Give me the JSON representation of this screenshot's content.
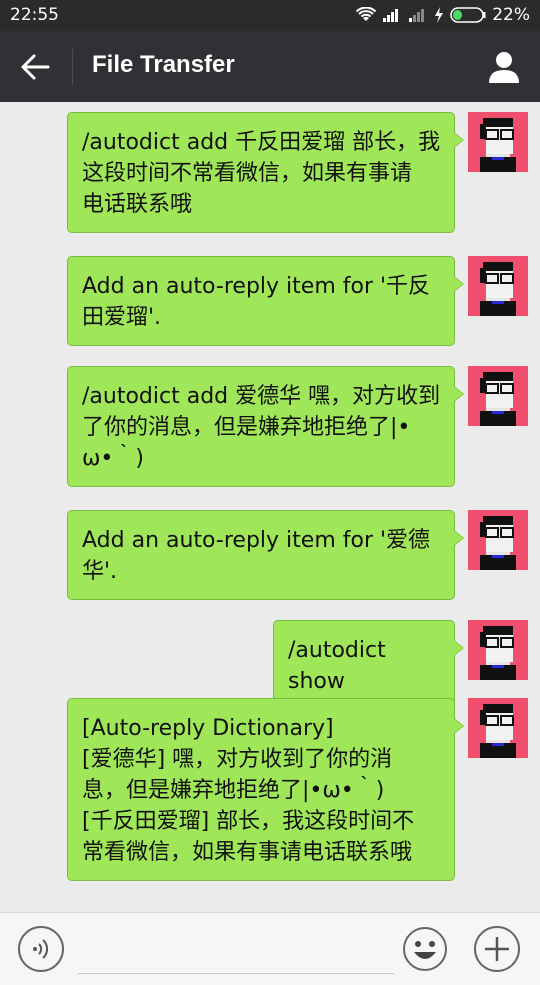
{
  "status_bar": {
    "time": "22:55",
    "battery_percent": "22%",
    "icons": [
      "wifi-icon",
      "signal-icon",
      "signal-icon-2",
      "charging-icon",
      "battery-icon"
    ]
  },
  "header": {
    "title": "File Transfer",
    "back_icon": "arrow-left-icon",
    "profile_icon": "person-icon",
    "bar_color": "#2f3134"
  },
  "messages": [
    {
      "text": "/autodict add 千反田爱瑠 部长，我这段时间不常看微信，如果有事请电话联系哦",
      "lines": [
        "/autodict add 千反田爱瑠 部长，我",
        "这段时间不常看微信，如果有事请",
        "电话联系哦"
      ]
    },
    {
      "text": "Add an auto-reply item for '千反田爱瑠'.",
      "lines": [
        "Add an auto-reply item for '千反",
        "田爱瑠'."
      ]
    },
    {
      "text": "/autodict add 爱德华 嘿，对方收到了你的消息，但是嫌弃地拒绝了|•ω•｀)",
      "lines": [
        "/autodict add 爱德华 嘿，对方收到",
        "了你的消息，但是嫌弃地拒绝了|•",
        "ω•｀)"
      ]
    },
    {
      "text": "Add an auto-reply item for '爱德华'.",
      "lines": [
        "Add an auto-reply item for '爱德",
        "华'."
      ]
    },
    {
      "text": "/autodict show",
      "lines": [
        "/autodict show"
      ]
    },
    {
      "text": "[Auto-reply Dictionary]",
      "lines": [
        "[Auto-reply Dictionary]",
        "[爱德华] 嘿，对方收到了你的消",
        "息，但是嫌弃地拒绝了|•ω•｀)",
        "[千反田爱瑠] 部长，我这段时间不",
        "常看微信，如果有事请电话联系哦"
      ]
    }
  ],
  "input_bar": {
    "placeholder": "",
    "voice_icon": "voice-icon",
    "emoji_icon": "emoji-icon",
    "plus_icon": "plus-icon"
  },
  "colors": {
    "bubble": "#9fe658",
    "chat_background": "#ebebeb",
    "avatar_background": "#f0506e"
  }
}
